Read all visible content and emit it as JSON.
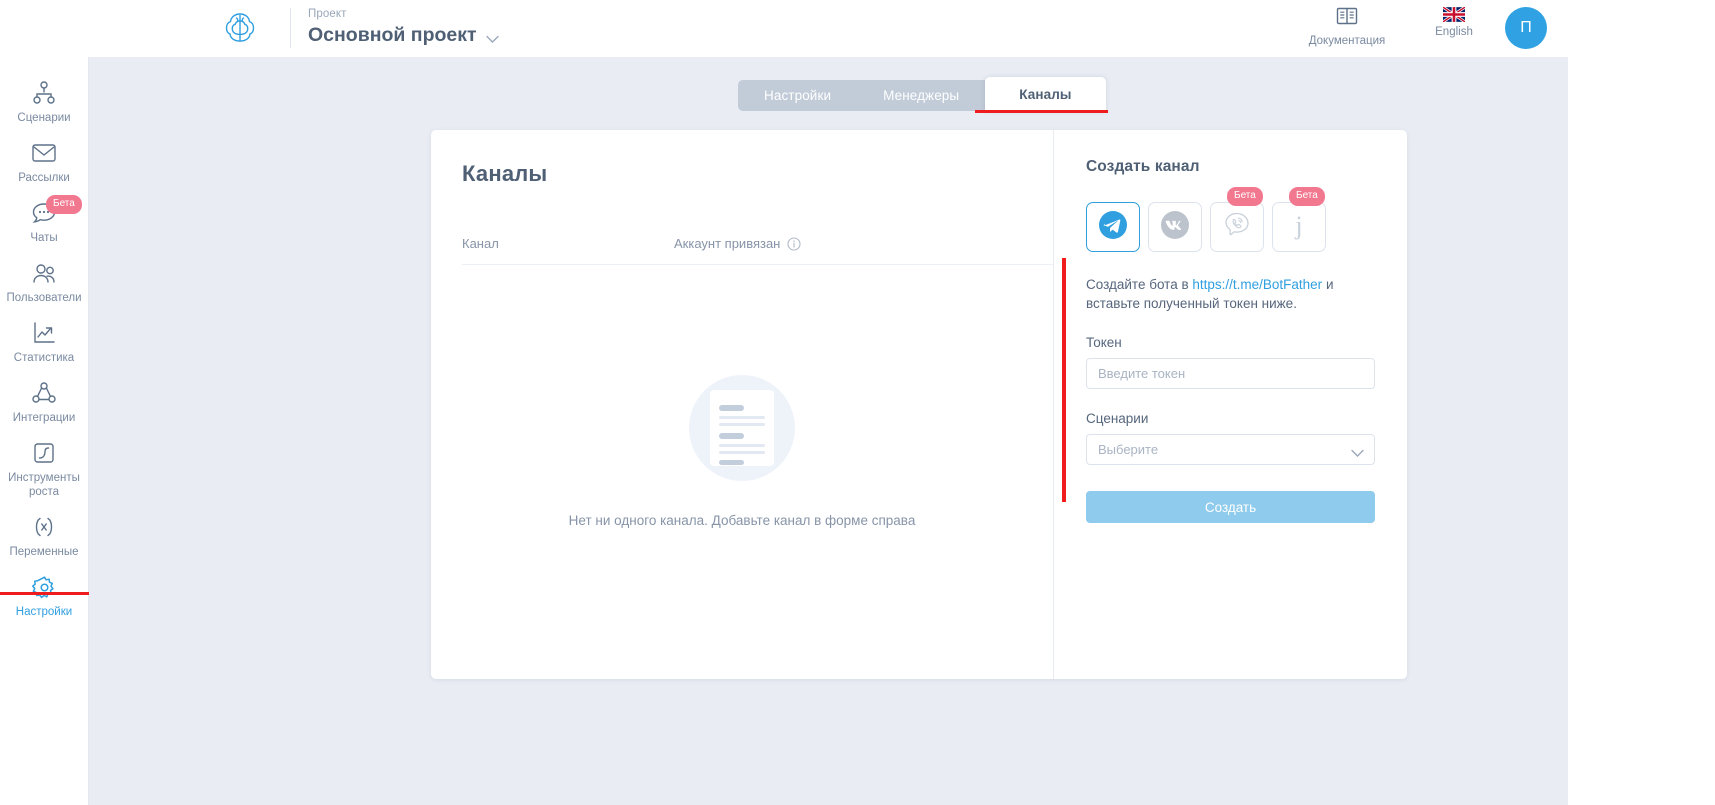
{
  "header": {
    "logo_icon": "brain-logo-icon",
    "project_label": "Проект",
    "project_name": "Основной проект",
    "chevron_icon": "chevron-down-icon",
    "documentation_label": "Документация",
    "documentation_icon": "book-icon",
    "language_label": "English",
    "language_icon": "uk-flag-icon",
    "avatar_initial": "П"
  },
  "sidebar": {
    "items": [
      {
        "label": "Сценарии",
        "icon": "sitemap-icon",
        "badge": null,
        "active": false
      },
      {
        "label": "Рассылки",
        "icon": "envelope-icon",
        "badge": null,
        "active": false
      },
      {
        "label": "Чаты",
        "icon": "chat-bubble-icon",
        "badge": "Бета",
        "active": false
      },
      {
        "label": "Пользователи",
        "icon": "users-icon",
        "badge": null,
        "active": false
      },
      {
        "label": "Статистика",
        "icon": "chart-line-icon",
        "badge": null,
        "active": false
      },
      {
        "label": "Интеграции",
        "icon": "integrations-icon",
        "badge": null,
        "active": false
      },
      {
        "label": "Инструменты роста",
        "icon": "growth-tools-icon",
        "badge": null,
        "active": false
      },
      {
        "label": "Переменные",
        "icon": "variable-icon",
        "badge": null,
        "active": false
      },
      {
        "label": "Настройки",
        "icon": "gear-icon",
        "badge": null,
        "active": true
      }
    ]
  },
  "tabs": [
    {
      "label": "Настройки",
      "active": false
    },
    {
      "label": "Менеджеры",
      "active": false
    },
    {
      "label": "Каналы",
      "active": true
    }
  ],
  "main": {
    "title": "Каналы",
    "table": {
      "columns": [
        "Канал",
        "Аккаунт привязан"
      ],
      "rows": [],
      "info_icon": "info-circle-icon"
    },
    "empty_state": {
      "illustration_icon": "empty-list-illustration-icon",
      "text": "Нет ни одного канала. Добавьте канал в форме справа"
    }
  },
  "create_panel": {
    "title": "Создать канал",
    "channels": [
      {
        "name": "telegram",
        "icon": "telegram-icon",
        "badge": null,
        "selected": true
      },
      {
        "name": "vkontakte",
        "icon": "vk-icon",
        "badge": null,
        "selected": false
      },
      {
        "name": "viber",
        "icon": "viber-icon",
        "badge": "Бета",
        "selected": false
      },
      {
        "name": "jivosite",
        "icon": "jivosite-icon",
        "badge": "Бета",
        "selected": false
      }
    ],
    "hint_before": "Создайте бота в ",
    "hint_link": "https://t.me/BotFather",
    "hint_after": " и вставьте полученный токен ниже.",
    "token_label": "Токен",
    "token_value": "",
    "token_placeholder": "Введите токен",
    "scenario_label": "Сценарии",
    "scenario_value": "",
    "scenario_placeholder": "Выберите",
    "scenario_chevron_icon": "chevron-down-icon",
    "submit_label": "Создать"
  },
  "colors": {
    "accent": "#2f9fe0",
    "badge_pink": "#f2788f",
    "annotation_red": "#ee1c1c",
    "page_bg": "#e9ecf3",
    "text_dark": "#4f6075",
    "text_muted": "#8794a8"
  }
}
